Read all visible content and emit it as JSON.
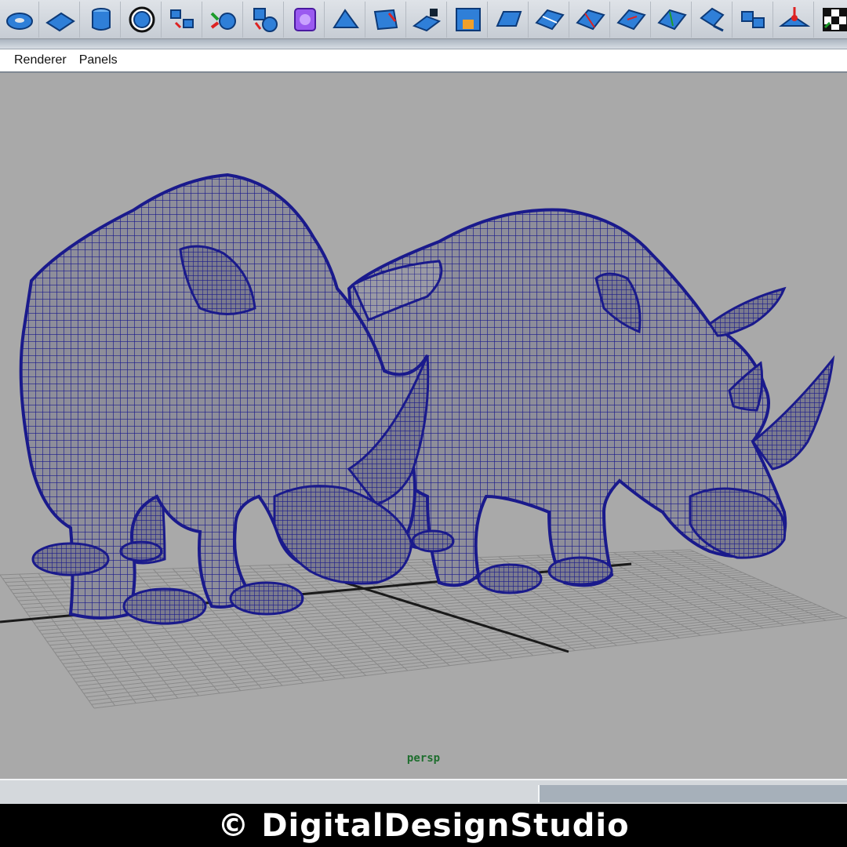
{
  "shelf": {
    "tools": [
      {
        "icon": "poly-torus-icon"
      },
      {
        "icon": "poly-plane-icon"
      },
      {
        "icon": "poly-cylinder-icon"
      },
      {
        "icon": "poly-soccerball-icon"
      },
      {
        "icon": "combine-icon"
      },
      {
        "icon": "separate-icon"
      },
      {
        "icon": "extract-icon"
      },
      {
        "icon": "smooth-cube-icon"
      },
      {
        "icon": "extrude-face-icon"
      },
      {
        "icon": "bridge-icon"
      },
      {
        "icon": "append-polygon-icon"
      },
      {
        "icon": "fill-hole-icon"
      },
      {
        "icon": "bevel-icon"
      },
      {
        "icon": "split-polygon-icon"
      },
      {
        "icon": "insert-edge-loop-icon"
      },
      {
        "icon": "offset-edge-loop-icon"
      },
      {
        "icon": "slide-edge-icon"
      },
      {
        "icon": "merge-vertices-icon"
      },
      {
        "icon": "poke-face-icon"
      },
      {
        "icon": "sculpt-geometry-icon"
      },
      {
        "icon": "uv-checker-icon"
      }
    ]
  },
  "menu": {
    "items": [
      "Renderer",
      "Panels"
    ]
  },
  "viewport": {
    "camera": "persp",
    "wireframe_color": "#1a1a8c",
    "background_color": "#a9a9a9"
  },
  "watermark": {
    "text": "© DigitalDesignStudio"
  }
}
